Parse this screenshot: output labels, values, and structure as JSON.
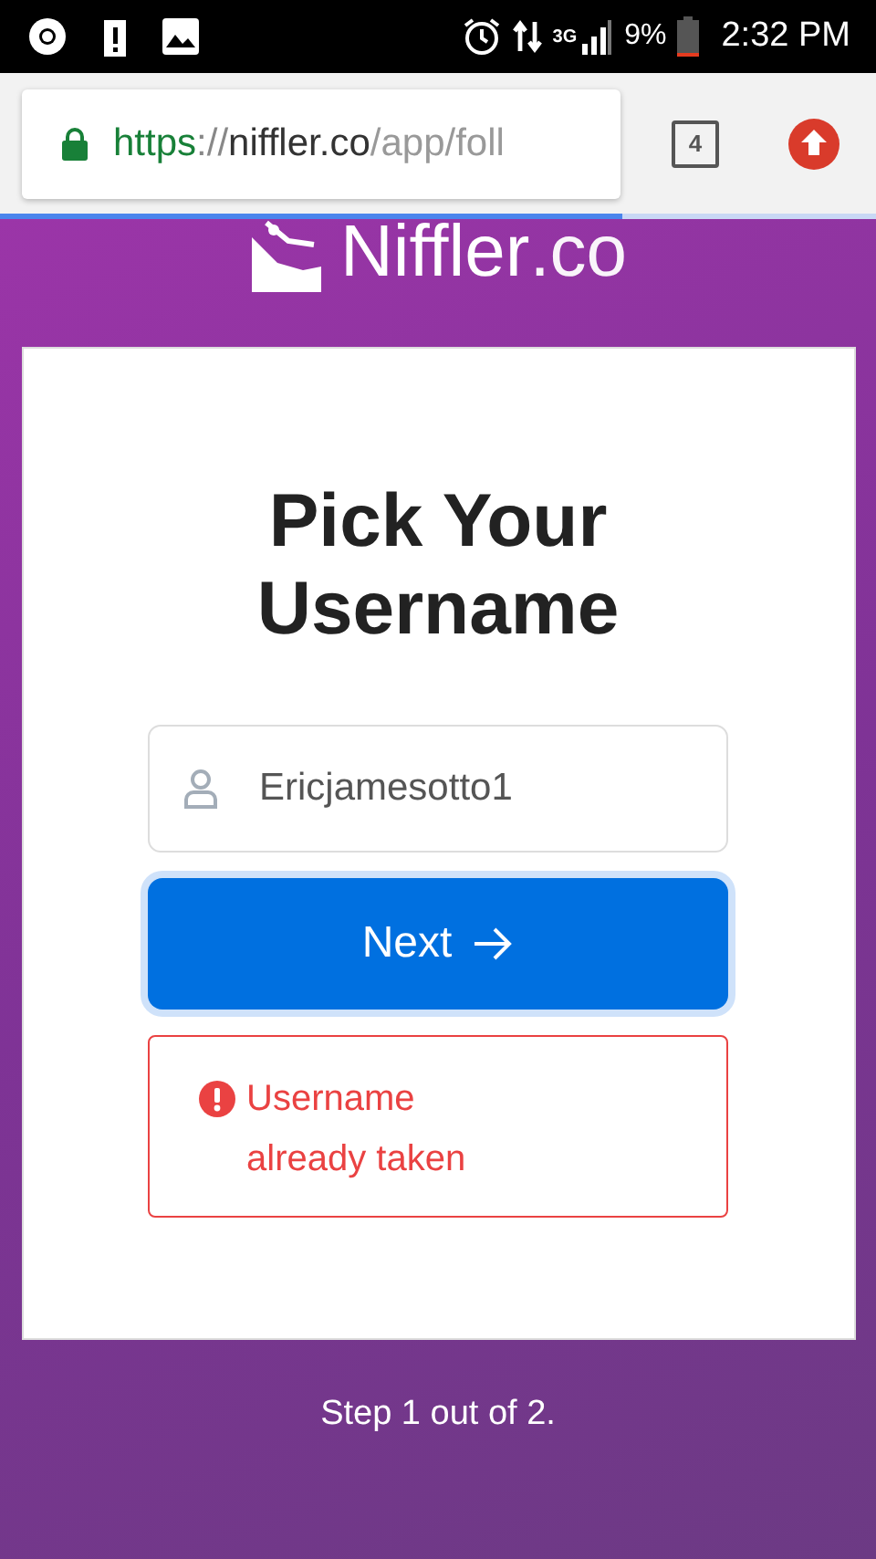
{
  "status_bar": {
    "network": "3G",
    "battery": "9%",
    "time": "2:32 PM"
  },
  "browser": {
    "url": [
      {
        "kind": "scheme",
        "text": "https"
      },
      {
        "kind": "sep",
        "text": "://"
      },
      {
        "kind": "host",
        "text": "niffler.co"
      },
      {
        "kind": "path",
        "text": "/app/foll"
      }
    ],
    "tab_count": "4",
    "page_load": {
      "level": 0.71
    }
  },
  "logo": {
    "name": "Niffler",
    "suffix": ".co"
  },
  "card": {
    "title": "Pick Your Username",
    "username_field": {
      "value": "Ericjamesotto1"
    },
    "next_button": "Next",
    "error": "Username already taken"
  },
  "footer": "Step 1 out of 2."
}
